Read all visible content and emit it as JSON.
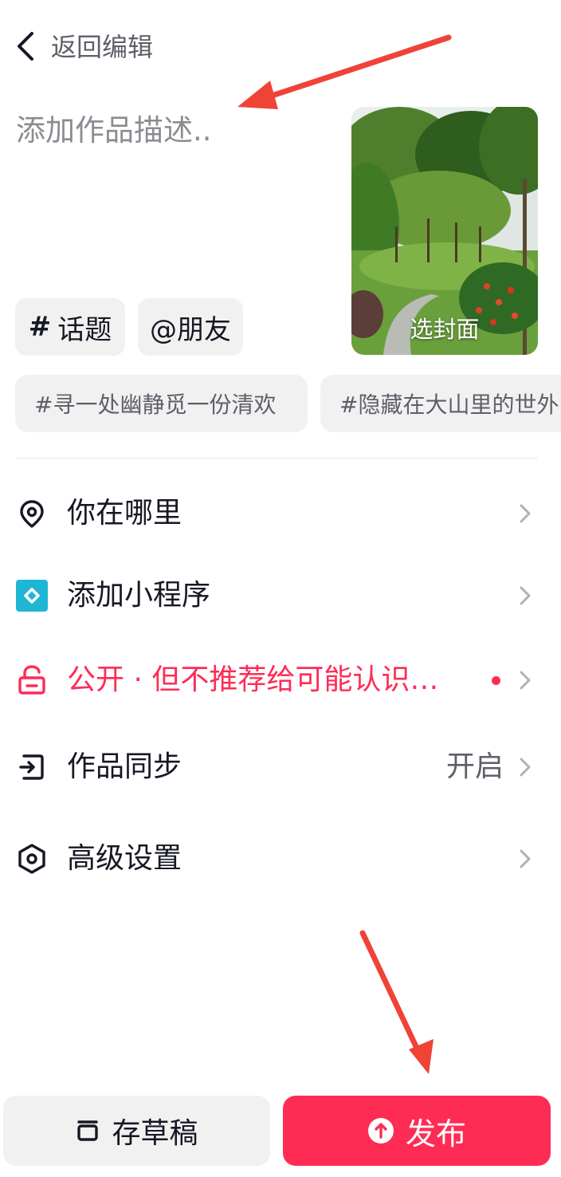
{
  "header": {
    "back_label": "返回编辑",
    "back_icon": "chevron-left-icon"
  },
  "description": {
    "placeholder": "添加作品描述..",
    "value": ""
  },
  "cover": {
    "label": "选封面"
  },
  "chips": {
    "topic_hash": "#",
    "topic_label": "话题",
    "friend_label": "@朋友"
  },
  "suggested_hashtags": [
    "#寻一处幽静觅一份清欢",
    "#隐藏在大山里的世外"
  ],
  "menu": {
    "location": {
      "label": "你在哪里",
      "icon": "location-pin-icon"
    },
    "mini_program": {
      "label": "添加小程序",
      "icon": "mini-program-icon",
      "icon_color": "#1fb6d6"
    },
    "privacy": {
      "label": "公开 · 但不推荐给可能认识…",
      "icon": "unlock-icon",
      "color": "#fe2c55"
    },
    "sync": {
      "label": "作品同步",
      "value": "开启",
      "icon": "sync-exit-icon"
    },
    "advanced": {
      "label": "高级设置",
      "icon": "hexagon-settings-icon"
    }
  },
  "buttons": {
    "draft_label": "存草稿",
    "publish_label": "发布",
    "accent": "#fe2c55"
  }
}
